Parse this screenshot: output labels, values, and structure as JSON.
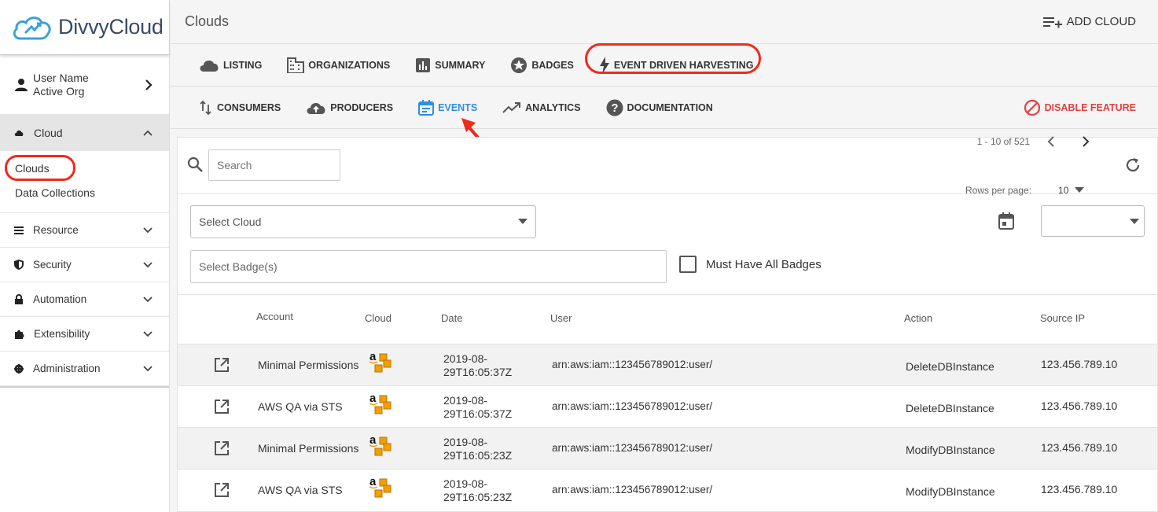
{
  "brand": {
    "name": "DivvyCloud"
  },
  "user": {
    "name": "User Name",
    "org": "Active Org"
  },
  "sidebar": {
    "cloud_label": "Cloud",
    "cloud_items": [
      {
        "label": "Clouds"
      },
      {
        "label": "Data Collections"
      }
    ],
    "sections": [
      {
        "label": "Resource",
        "icon": "list-icon"
      },
      {
        "label": "Security",
        "icon": "shield-icon"
      },
      {
        "label": "Automation",
        "icon": "lock-icon"
      },
      {
        "label": "Extensibility",
        "icon": "puzzle-icon"
      },
      {
        "label": "Administration",
        "icon": "gear-icon"
      }
    ]
  },
  "header": {
    "title": "Clouds",
    "add_cloud_label": "ADD CLOUD"
  },
  "tabs_primary": [
    {
      "label": "LISTING",
      "icon": "cloud-icon"
    },
    {
      "label": "ORGANIZATIONS",
      "icon": "building-icon"
    },
    {
      "label": "SUMMARY",
      "icon": "bar-chart-icon"
    },
    {
      "label": "BADGES",
      "icon": "star-badge-icon"
    },
    {
      "label": "EVENT DRIVEN HARVESTING",
      "icon": "lightning-icon"
    }
  ],
  "tabs_secondary": [
    {
      "label": "CONSUMERS",
      "icon": "sort-arrows-icon"
    },
    {
      "label": "PRODUCERS",
      "icon": "cloud-upload-icon"
    },
    {
      "label": "EVENTS",
      "icon": "calendar-icon",
      "active": true
    },
    {
      "label": "ANALYTICS",
      "icon": "trend-line-icon"
    },
    {
      "label": "DOCUMENTATION",
      "icon": "help-circle-icon"
    }
  ],
  "disable_feature_label": "DISABLE FEATURE",
  "search": {
    "placeholder": "Search"
  },
  "pagination": {
    "range": "1 - 10 of 521",
    "rows_per_page_label": "Rows per page:",
    "rows_per_page_value": "10"
  },
  "filters": {
    "select_cloud_placeholder": "Select Cloud",
    "select_badges_placeholder": "Select Badge(s)",
    "must_have_all_label": "Must Have All Badges"
  },
  "table": {
    "columns": [
      "Account",
      "Cloud",
      "Date",
      "User",
      "Action",
      "Source IP"
    ],
    "rows": [
      {
        "account": "Minimal Permissions",
        "cloud": "aws",
        "date": "2019-08-29T16:05:37Z",
        "user": "arn:aws:iam::123456789012:user/",
        "action": "DeleteDBInstance",
        "source_ip": "123.456.789.10"
      },
      {
        "account": "AWS QA via STS",
        "cloud": "aws",
        "date": "2019-08-29T16:05:37Z",
        "user": "arn:aws:iam::123456789012:user/",
        "action": "DeleteDBInstance",
        "source_ip": "123.456.789.10"
      },
      {
        "account": "Minimal Permissions",
        "cloud": "aws",
        "date": "2019-08-29T16:05:23Z",
        "user": "arn:aws:iam::123456789012:user/",
        "action": "ModifyDBInstance",
        "source_ip": "123.456.789.10"
      },
      {
        "account": "AWS QA via STS",
        "cloud": "aws",
        "date": "2019-08-29T16:05:23Z",
        "user": "arn:aws:iam::123456789012:user/",
        "action": "ModifyDBInstance",
        "source_ip": "123.456.789.10"
      }
    ]
  },
  "colors": {
    "accent": "#2f8ee0",
    "danger": "#e04040",
    "annotation": "#f02a1c"
  }
}
